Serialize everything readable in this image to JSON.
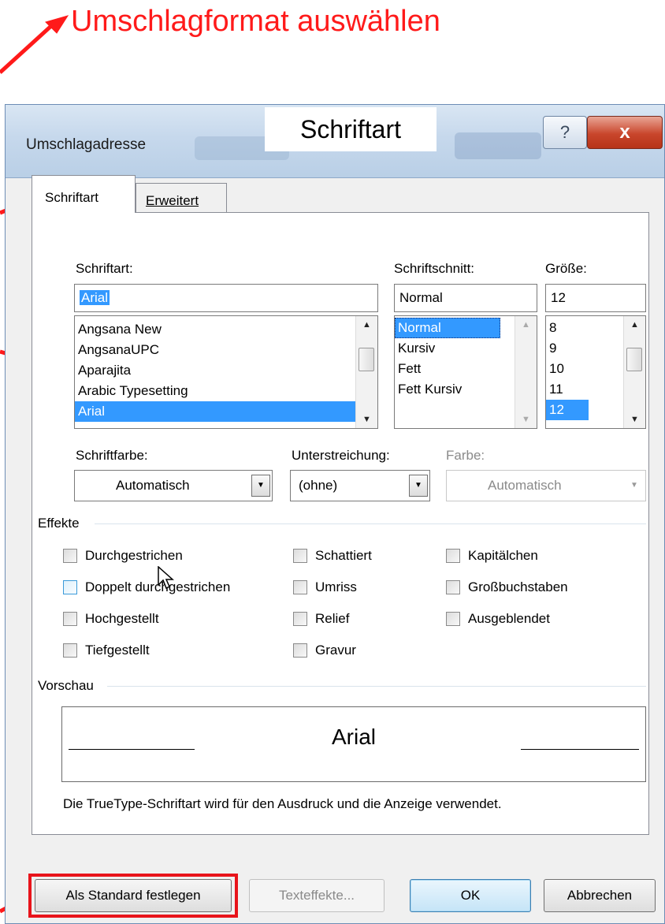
{
  "annotation": {
    "title": "Umschlagformat auswählen",
    "callout": "Schriftart",
    "color": "#ff1a1a"
  },
  "dialog": {
    "title": "Umschlagadresse",
    "help_label": "?",
    "close_label": "x"
  },
  "tabs": [
    {
      "label": "Schriftart",
      "active": true
    },
    {
      "label": "Erweitert",
      "active": false
    }
  ],
  "font": {
    "label": "Schriftart:",
    "value": "Arial",
    "list": [
      "Angsana New",
      "AngsanaUPC",
      "Aparajita",
      "Arabic Typesetting",
      "Arial"
    ],
    "selected": "Arial"
  },
  "style": {
    "label": "Schriftschnitt:",
    "value": "Normal",
    "list": [
      "Normal",
      "Kursiv",
      "Fett",
      "Fett Kursiv"
    ],
    "selected": "Normal"
  },
  "size": {
    "label": "Größe:",
    "value": "12",
    "list": [
      "8",
      "9",
      "10",
      "11",
      "12"
    ],
    "selected": "12"
  },
  "font_color": {
    "label": "Schriftfarbe:",
    "value": "Automatisch"
  },
  "underline": {
    "label": "Unterstreichung:",
    "value": "(ohne)"
  },
  "underline_color": {
    "label": "Farbe:",
    "value": "Automatisch",
    "disabled": true
  },
  "effects": {
    "label": "Effekte",
    "items": [
      {
        "label": "Durchgestrichen",
        "checked": false
      },
      {
        "label": "Doppelt durchgestrichen",
        "checked": false
      },
      {
        "label": "Hochgestellt",
        "checked": false
      },
      {
        "label": "Tiefgestellt",
        "checked": false
      },
      {
        "label": "Schattiert",
        "checked": false
      },
      {
        "label": "Umriss",
        "checked": false
      },
      {
        "label": "Relief",
        "checked": false
      },
      {
        "label": "Gravur",
        "checked": false
      },
      {
        "label": "Kapitälchen",
        "checked": false
      },
      {
        "label": "Großbuchstaben",
        "checked": false
      },
      {
        "label": "Ausgeblendet",
        "checked": false
      }
    ]
  },
  "preview": {
    "label": "Vorschau",
    "sample": "Arial",
    "note": "Die TrueType-Schriftart wird für den Ausdruck und die Anzeige verwendet."
  },
  "buttons": {
    "set_default": "Als Standard festlegen",
    "text_effects": "Texteffekte...",
    "ok": "OK",
    "cancel": "Abbrechen"
  }
}
